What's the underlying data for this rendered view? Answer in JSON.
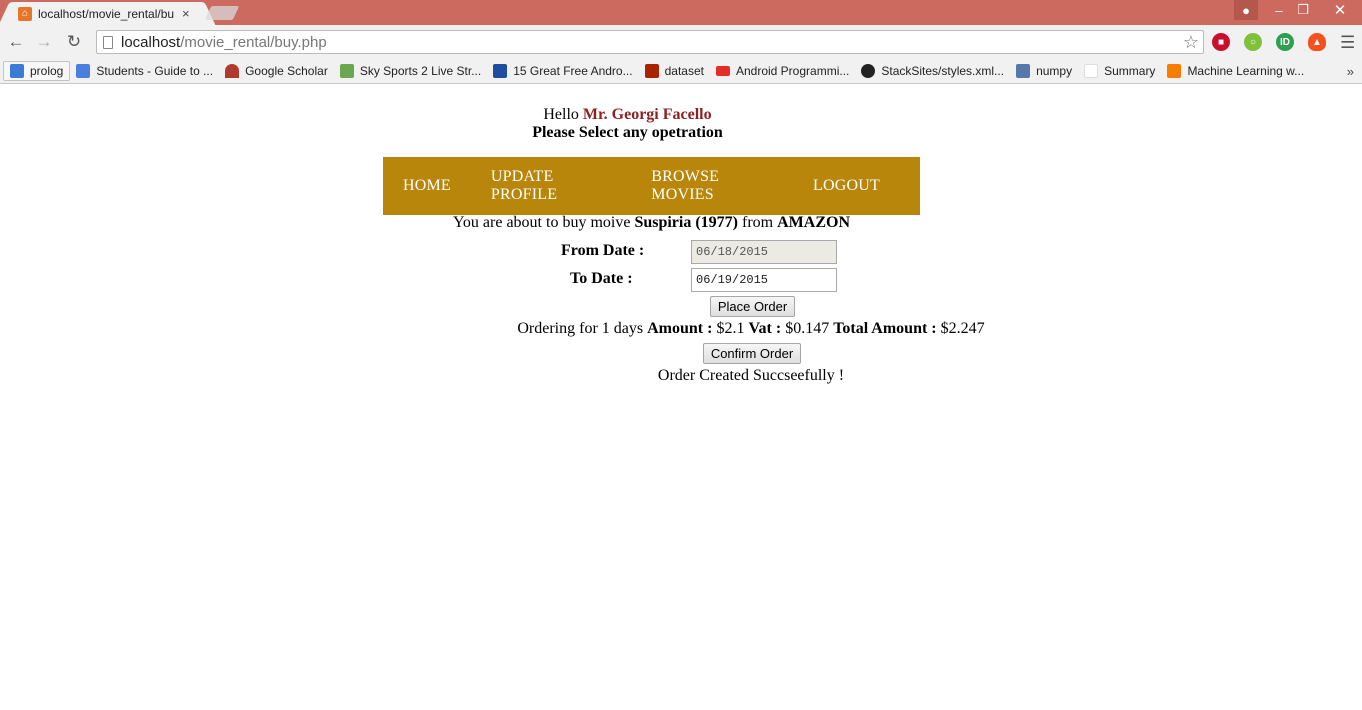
{
  "browser": {
    "tab": {
      "title": "localhost/movie_rental/bu",
      "favicon": "xampp-icon",
      "close": "×"
    },
    "address": {
      "host": "localhost",
      "path": "/movie_rental/buy.php"
    },
    "bookmarks": [
      {
        "label": "prolog",
        "icon": "prolog-icon",
        "color": "#3a7bd5"
      },
      {
        "label": "Students - Guide to ...",
        "icon": "google-plus-icon",
        "color": "#4a7fe0"
      },
      {
        "label": "Google Scholar",
        "icon": "scholar-icon",
        "color": "#b03a2e"
      },
      {
        "label": "Sky Sports 2 Live Str...",
        "icon": "tv-icon",
        "color": "#6aa84f"
      },
      {
        "label": "15 Great Free Andro...",
        "icon": "efy-icon",
        "color": "#1f4e9e"
      },
      {
        "label": "dataset",
        "icon": "quora-icon",
        "color": "#a82400"
      },
      {
        "label": "Android Programmi...",
        "icon": "youtube-icon",
        "color": "#e52d27"
      },
      {
        "label": "StackSites/styles.xml...",
        "icon": "github-icon",
        "color": "#222222"
      },
      {
        "label": "numpy",
        "icon": "numpy-icon",
        "color": "#5577aa"
      },
      {
        "label": "Summary",
        "icon": "page-icon",
        "color": "#dddddd"
      },
      {
        "label": "Machine Learning w...",
        "icon": "blogger-icon",
        "color": "#f57d00"
      }
    ],
    "more": "»"
  },
  "greeting": {
    "hello": "Hello",
    "name": "Mr. Georgi Facello",
    "prompt": "Please Select any opetration"
  },
  "nav": [
    "HOME",
    "UPDATE PROFILE",
    "BROWSE MOVIES",
    "LOGOUT"
  ],
  "buy": {
    "prefix": "You are about to buy moive",
    "movie": "Suspiria (1977)",
    "from_word": "from",
    "store": "AMAZON"
  },
  "form": {
    "from_label": "From Date :",
    "from_value": "06/18/2015",
    "to_label": "To Date :",
    "to_value": "06/19/2015",
    "place_order": "Place Order",
    "confirm_order": "Confirm Order"
  },
  "order": {
    "prefix": "Ordering for 1 days",
    "amount_label": "Amount :",
    "amount": "$2.1",
    "vat_label": "Vat :",
    "vat": "$0.147",
    "total_label": "Total Amount :",
    "total": "$2.247"
  },
  "status": "Order Created Succseefully !"
}
